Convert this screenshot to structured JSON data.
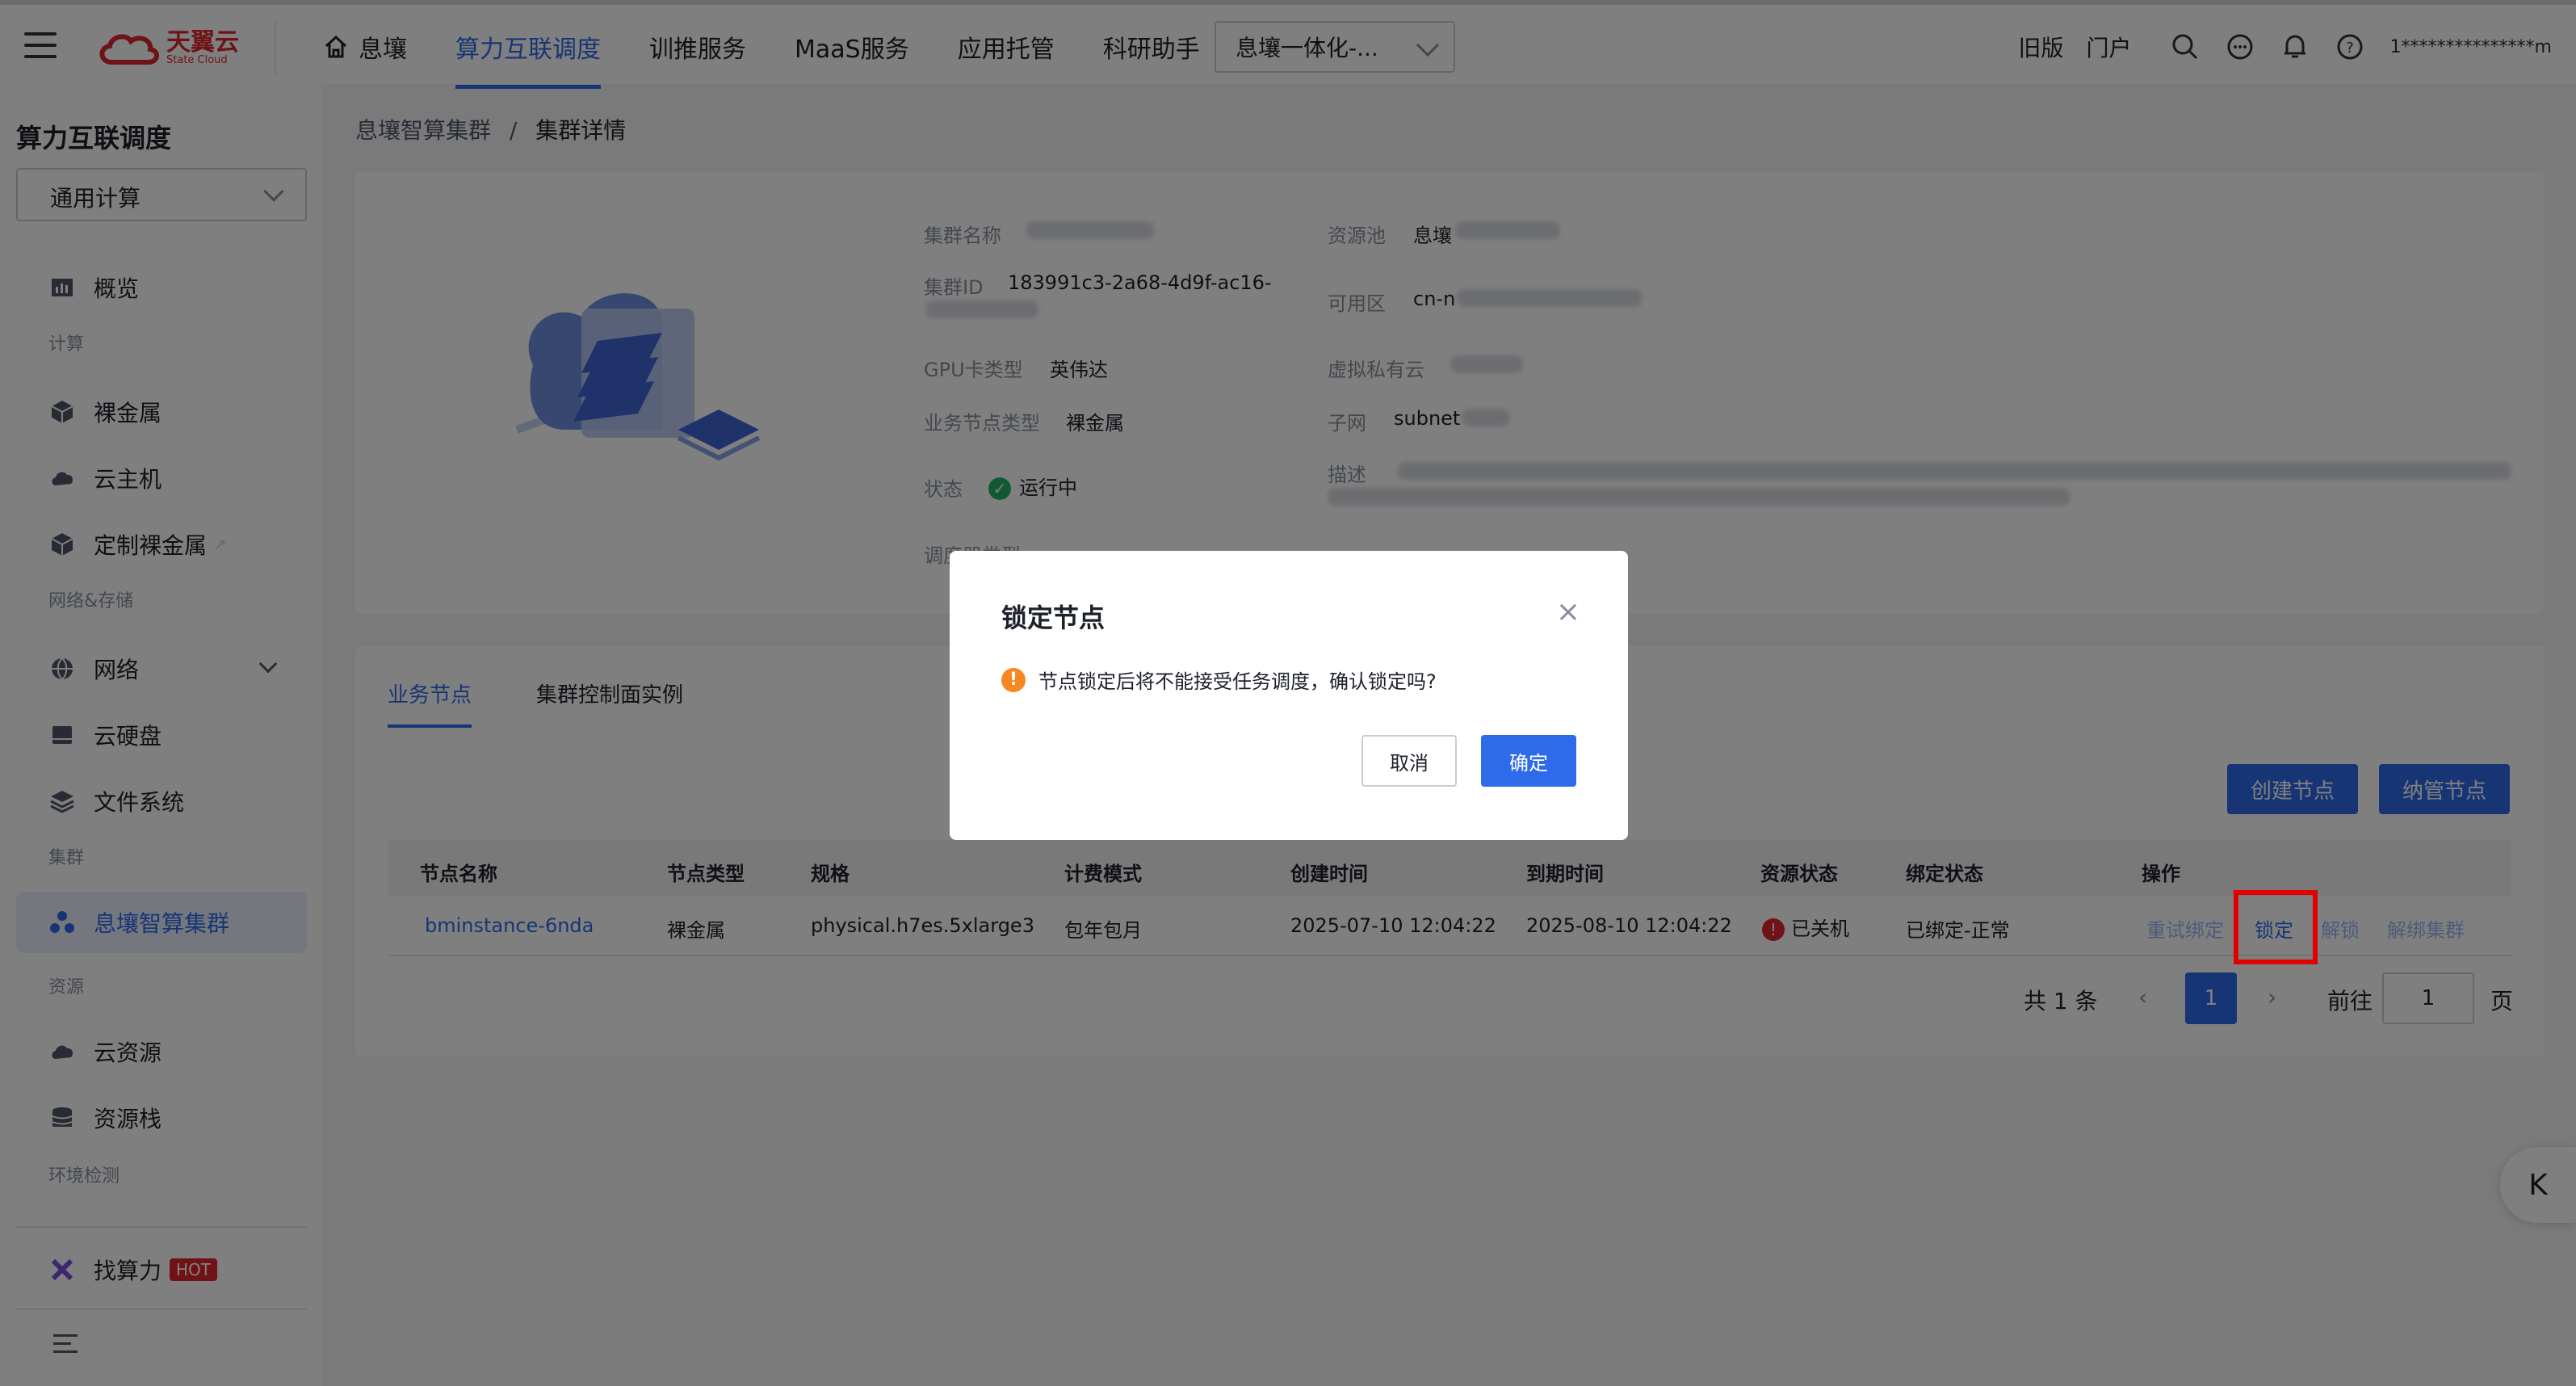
{
  "topbar": {
    "logo_cn": "天翼云",
    "logo_en": "State Cloud",
    "nav": [
      "息壤",
      "算力互联调度",
      "训推服务",
      "MaaS服务",
      "应用托管",
      "科研助手"
    ],
    "workspace": "息壤一体化-...",
    "old_version": "旧版",
    "portal": "门户",
    "user": "1***************m"
  },
  "sidebar": {
    "title": "算力互联调度",
    "select": "通用计算",
    "items": {
      "overview": "概览",
      "g_compute": "计算",
      "baremetal": "裸金属",
      "ecs": "云主机",
      "custom_bm": "定制裸金属",
      "g_net": "网络&存储",
      "network": "网络",
      "disk": "云硬盘",
      "fs": "文件系统",
      "g_cluster": "集群",
      "cluster": "息壤智算集群",
      "g_resource": "资源",
      "cloud_res": "云资源",
      "res_stack": "资源栈",
      "g_env": "环境检测",
      "find_power": "找算力",
      "hot": "HOT"
    }
  },
  "breadcrumb": {
    "parent": "息壤智算集群",
    "sep": "/",
    "current": "集群详情"
  },
  "info": {
    "name_label": "集群名称",
    "id_label": "集群ID",
    "id_value": "183991c3-2a68-4d9f-ac16-",
    "gpu_label": "GPU卡类型",
    "gpu_value": "英伟达",
    "node_type_label": "业务节点类型",
    "node_type_value": "裸金属",
    "status_label": "状态",
    "status_value": "运行中",
    "sched_label": "调度器类型",
    "pool_label": "资源池",
    "pool_value": "息壤",
    "az_label": "可用区",
    "az_value": "cn-n",
    "vpc_label": "虚拟私有云",
    "subnet_label": "子网",
    "subnet_value": "subnet",
    "desc_label": "描述"
  },
  "tabs": [
    "业务节点",
    "集群控制面实例"
  ],
  "buttons": {
    "create_node": "创建节点",
    "manage_node": "纳管节点"
  },
  "table": {
    "headers": [
      "节点名称",
      "节点类型",
      "规格",
      "计费模式",
      "创建时间",
      "到期时间",
      "资源状态",
      "绑定状态",
      "操作"
    ],
    "rows": [
      {
        "name": "bminstance-6nda",
        "type": "裸金属",
        "spec": "physical.h7es.5xlarge3",
        "billing": "包年包月",
        "created": "2025-07-10 12:04:22",
        "expires": "2025-08-10 12:04:22",
        "res_status": "已关机",
        "bind_status": "已绑定-正常",
        "ops": [
          "重试绑定",
          "锁定",
          "解锁",
          "解绑集群"
        ]
      }
    ]
  },
  "pager": {
    "total": "共 1 条",
    "current": "1",
    "goto": "前往",
    "goto_value": "1",
    "page": "页"
  },
  "modal": {
    "title": "锁定节点",
    "message": "节点锁定后将不能接受任务调度，确认锁定吗?",
    "cancel": "取消",
    "confirm": "确定"
  }
}
